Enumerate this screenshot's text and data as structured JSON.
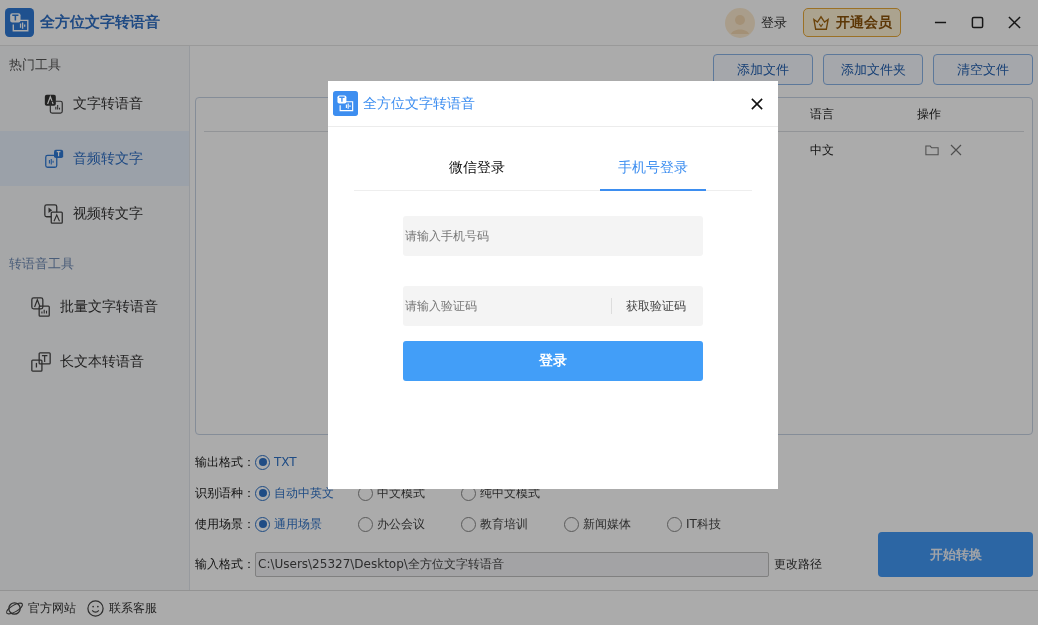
{
  "window": {
    "title": "全方位文字转语音",
    "login": "登录",
    "vip": "开通会员"
  },
  "sidebar": {
    "sections": [
      {
        "title": "热门工具",
        "items": [
          {
            "label": "文字转语音",
            "selected": false,
            "kind": "text"
          },
          {
            "label": "音频转文字",
            "selected": true,
            "kind": "audio"
          },
          {
            "label": "视频转文字",
            "selected": false,
            "kind": "video"
          }
        ]
      },
      {
        "title": "转语音工具",
        "items": [
          {
            "label": "批量文字转语音",
            "selected": false,
            "kind": "batch"
          },
          {
            "label": "长文本转语音",
            "selected": false,
            "kind": "long"
          }
        ]
      }
    ]
  },
  "toolbar": [
    "添加文件",
    "添加文件夹",
    "清空文件"
  ],
  "table": {
    "columns": [
      "语言",
      "操作"
    ],
    "rows": [
      {
        "language": "中文"
      }
    ]
  },
  "options": [
    {
      "label": "输出格式：",
      "choices": [
        {
          "label": "TXT",
          "selected": true
        }
      ]
    },
    {
      "label": "识别语种：",
      "choices": [
        {
          "label": "自动中英文",
          "selected": true
        },
        {
          "label": "中文模式",
          "selected": false
        },
        {
          "label": "纯中文模式",
          "selected": false
        }
      ]
    },
    {
      "label": "使用场景：",
      "choices": [
        {
          "label": "通用场景",
          "selected": true
        },
        {
          "label": "办公会议",
          "selected": false
        },
        {
          "label": "教育培训",
          "selected": false
        },
        {
          "label": "新闻媒体",
          "selected": false
        },
        {
          "label": "IT科技",
          "selected": false
        }
      ]
    }
  ],
  "path": {
    "label": "输入格式：",
    "value": "C:\\Users\\25327\\Desktop\\全方位文字转语音",
    "change": "更改路径"
  },
  "start_button": "开始转换",
  "footer": [
    "官方网站",
    "联系客服"
  ],
  "dialog": {
    "title": "全方位文字转语音",
    "tabs": [
      {
        "label": "微信登录",
        "selected": false
      },
      {
        "label": "手机号登录",
        "selected": true
      }
    ],
    "phone": {
      "placeholder": "请输入手机号码"
    },
    "code": {
      "placeholder": "请输入验证码",
      "action": "获取验证码"
    },
    "submit": "登录"
  }
}
